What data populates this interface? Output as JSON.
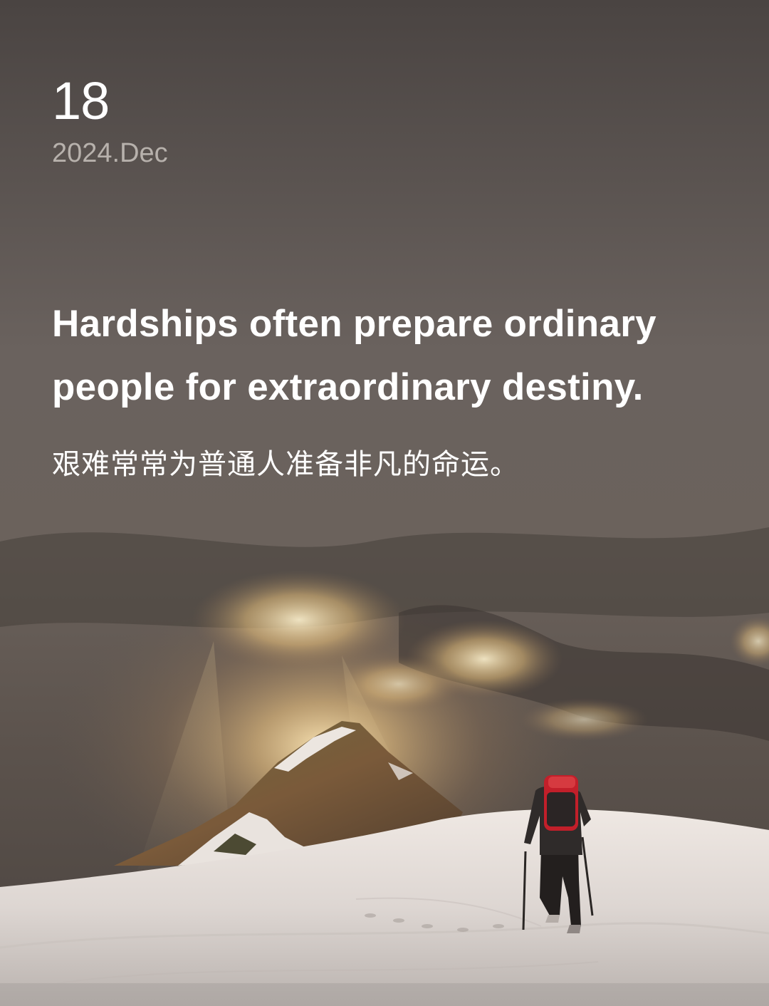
{
  "date": {
    "day": "18",
    "month_year": "2024.Dec"
  },
  "quote": {
    "english": "Hardships often prepare ordinary people for extraordinary destiny.",
    "chinese": "艰难常常为普通人准备非凡的命运。"
  },
  "colors": {
    "sky_top": "#4d4745",
    "sky_mid": "#6f6661",
    "sun_glow": "#f5d79a",
    "snow": "#e8e3df",
    "backpack": "#c21f2a",
    "text_primary": "#ffffff",
    "text_secondary": "#b7b1ac"
  }
}
